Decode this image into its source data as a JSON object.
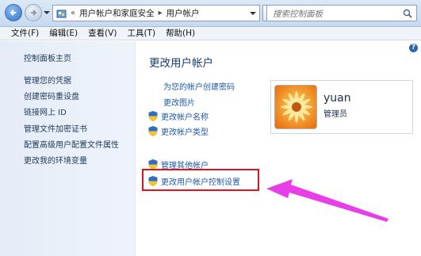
{
  "addressbar": {
    "overflow": "«",
    "crumb1": "用户帐户和家庭安全",
    "separator": "▸",
    "crumb2": "用户帐户",
    "search_placeholder": "搜索控制面板"
  },
  "menubar": {
    "items": [
      "文件(F)",
      "编辑(E)",
      "查看(V)",
      "工具(T)",
      "帮助(H)"
    ]
  },
  "sidebar": {
    "home": "控制面板主页",
    "items": [
      "管理您的凭据",
      "创建密码重设盘",
      "链接网上 ID",
      "管理文件加密证书",
      "配置高级用户配置文件属性",
      "更改我的环境变量"
    ]
  },
  "main": {
    "help": "?",
    "title": "更改用户帐户",
    "tasks": [
      "为您的帐户创建密码",
      "更改图片",
      "更改帐户名称",
      "更改帐户类型"
    ],
    "other_tasks": [
      "管理其他帐户",
      "更改用户帐户控制设置"
    ]
  },
  "user": {
    "name": "yuan",
    "role": "管理员"
  },
  "colors": {
    "highlight_box": "#e0121a",
    "annotation_arrow": "#e83ee8",
    "link": "#1e5aa8"
  }
}
